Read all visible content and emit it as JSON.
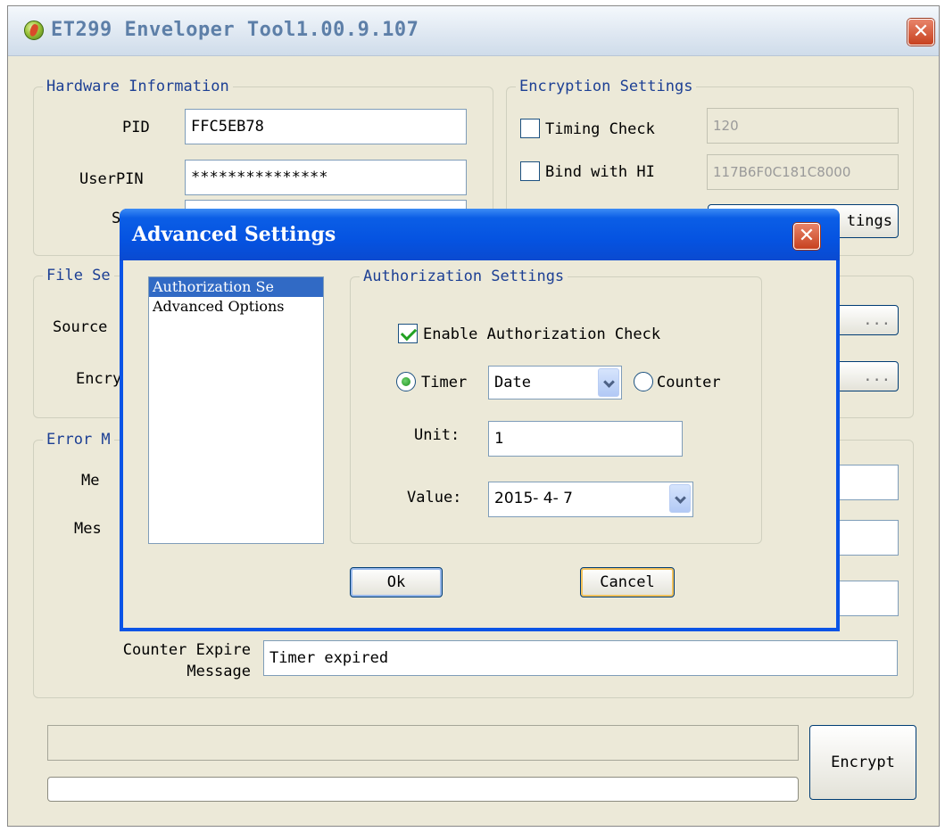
{
  "window": {
    "title": "ET299 Enveloper Tool1.00.9.107",
    "close_glyph": "✕"
  },
  "hardware": {
    "legend": "Hardware Information",
    "pid_label": "PID",
    "pid_value": "FFC5EB78",
    "userpin_label": "UserPIN",
    "userpin_value": "***************",
    "so_label_partial": "SO"
  },
  "encryption": {
    "legend": "Encryption Settings",
    "timing_check_label": "Timing Check",
    "timing_check_checked": false,
    "timing_value": "120",
    "bind_hi_label": "Bind with HI",
    "bind_hi_checked": false,
    "bind_value": "117B6F0C181C8000",
    "settings_button_partial": "tings"
  },
  "file": {
    "legend_partial": "File Se",
    "source_label_partial": "Source",
    "encrypted_label_partial": "Encry",
    "browse_label": "..."
  },
  "error": {
    "legend_partial": "Error M",
    "msg1_label_partial": "Me",
    "msg2_label_partial": "Mes",
    "counter_expire_label_line1": "Counter Expire",
    "counter_expire_label_line2": "Message",
    "counter_expire_value": "Timer expired"
  },
  "encrypt_button": "Encrypt",
  "dialog": {
    "title": "Advanced Settings",
    "list_items": [
      "Authorization Se",
      "Advanced Options"
    ],
    "selected_index": 0,
    "group_legend": "Authorization Settings",
    "enable_check_label": "Enable Authorization Check",
    "enable_check_checked": true,
    "timer_label": "Timer",
    "timer_selected": true,
    "timer_mode": "Date",
    "counter_label": "Counter",
    "counter_selected": false,
    "unit_label": "Unit:",
    "unit_value": "1",
    "value_label": "Value:",
    "value_date": "2015- 4- 7",
    "ok_label": "Ok",
    "cancel_label": "Cancel"
  }
}
